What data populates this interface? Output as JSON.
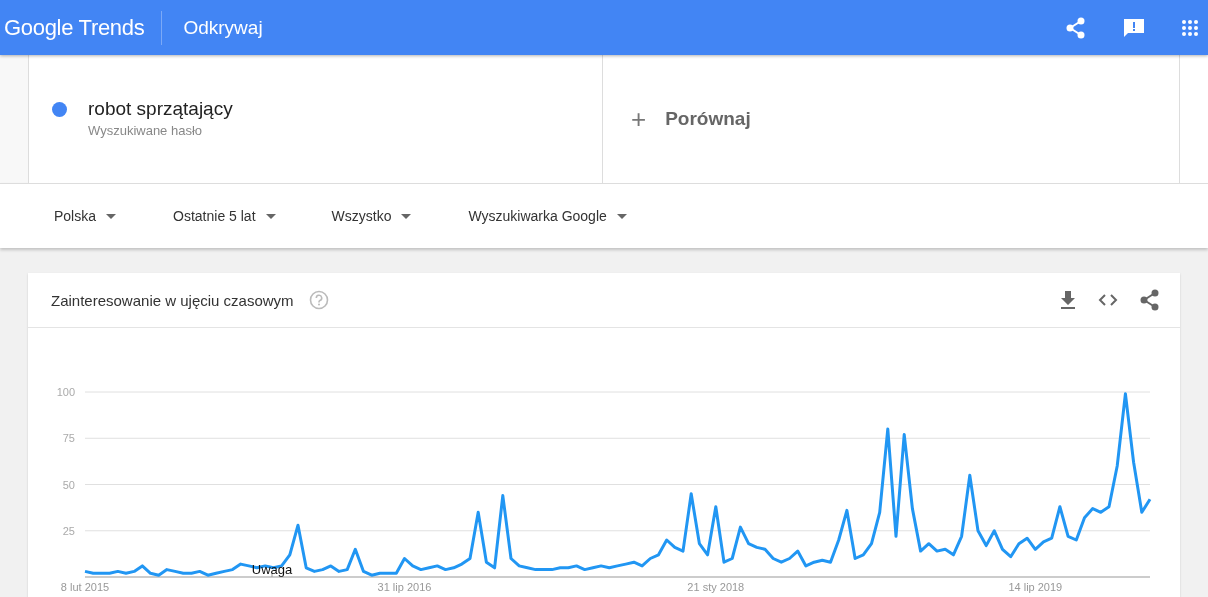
{
  "header": {
    "logo": "Google Trends",
    "section": "Odkrywaj"
  },
  "terms": [
    {
      "name": "robot sprzątający",
      "subtitle": "Wyszukiwane hasło",
      "color": "#4285f4"
    }
  ],
  "compare": {
    "icon": "+",
    "label": "Porównaj"
  },
  "filters": [
    {
      "label": "Polska"
    },
    {
      "label": "Ostatnie 5 lat"
    },
    {
      "label": "Wszystko"
    },
    {
      "label": "Wyszukiwarka Google"
    }
  ],
  "interest_card": {
    "title": "Zainteresowanie w ujęciu czasowym",
    "chart_data": {
      "type": "line",
      "grid": true,
      "ylim": [
        0,
        100
      ],
      "yticks": [
        25,
        50,
        75,
        100
      ],
      "categories": [
        "8 lut 2015",
        null,
        null,
        null,
        null,
        null,
        null,
        null,
        null,
        null,
        null,
        null,
        null,
        null,
        null,
        null,
        null,
        null,
        null,
        null,
        null,
        null,
        null,
        null,
        null,
        null,
        null,
        null,
        null,
        null,
        null,
        null,
        null,
        null,
        null,
        null,
        null,
        null,
        null,
        "31 lip 2016",
        null,
        null,
        null,
        null,
        null,
        null,
        null,
        null,
        null,
        null,
        null,
        null,
        null,
        null,
        null,
        null,
        null,
        null,
        null,
        null,
        null,
        null,
        null,
        null,
        null,
        null,
        null,
        null,
        null,
        null,
        null,
        null,
        null,
        null,
        null,
        null,
        null,
        "21 sty 2018",
        null,
        null,
        null,
        null,
        null,
        null,
        null,
        null,
        null,
        null,
        null,
        null,
        null,
        null,
        null,
        null,
        null,
        null,
        null,
        null,
        null,
        null,
        null,
        null,
        null,
        null,
        null,
        null,
        null,
        null,
        null,
        null,
        null,
        null,
        null,
        null,
        null,
        null,
        "14 lip 2019",
        null,
        null,
        null,
        null,
        null,
        null,
        null,
        null,
        null,
        null,
        null,
        null,
        null,
        null
      ],
      "annotations": [
        {
          "text": "Uwaga"
        }
      ],
      "series": [
        {
          "color": "#2196f3",
          "values": [
            3,
            2,
            2,
            2,
            3,
            2,
            3,
            6,
            2,
            1,
            4,
            3,
            2,
            2,
            3,
            1,
            2,
            3,
            4,
            7,
            6,
            5,
            6,
            5,
            6,
            12,
            28,
            5,
            3,
            4,
            6,
            3,
            4,
            15,
            3,
            1,
            2,
            2,
            2,
            10,
            6,
            4,
            5,
            6,
            4,
            5,
            7,
            10,
            35,
            8,
            5,
            44,
            10,
            6,
            5,
            4,
            4,
            4,
            5,
            5,
            6,
            4,
            5,
            6,
            5,
            6,
            7,
            8,
            6,
            10,
            12,
            20,
            16,
            14,
            45,
            18,
            12,
            38,
            8,
            10,
            27,
            18,
            16,
            15,
            10,
            8,
            10,
            14,
            6,
            8,
            9,
            8,
            20,
            36,
            10,
            12,
            18,
            35,
            80,
            22,
            77,
            37,
            14,
            18,
            14,
            15,
            12,
            22,
            55,
            25,
            17,
            25,
            15,
            11,
            18,
            21,
            15,
            19,
            21,
            38,
            22,
            20,
            32,
            37,
            35,
            38,
            60,
            99,
            62,
            35,
            42
          ]
        }
      ]
    }
  }
}
